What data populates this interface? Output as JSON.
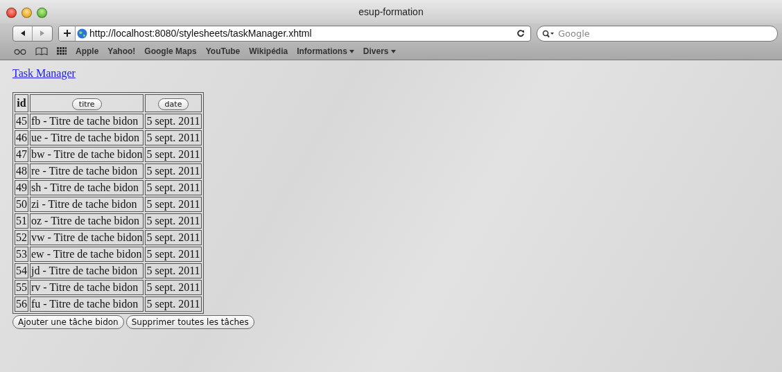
{
  "window": {
    "title": "esup-formation"
  },
  "toolbar": {
    "url": "http://localhost:8080/stylesheets/taskManager.xhtml",
    "search": {
      "placeholder": "Google"
    }
  },
  "bookmarks": [
    {
      "label": "Apple",
      "menu": false
    },
    {
      "label": "Yahoo!",
      "menu": false
    },
    {
      "label": "Google Maps",
      "menu": false
    },
    {
      "label": "YouTube",
      "menu": false
    },
    {
      "label": "Wikipédia",
      "menu": false
    },
    {
      "label": "Informations",
      "menu": true
    },
    {
      "label": "Divers",
      "menu": true
    }
  ],
  "page": {
    "heading_link": "Task Manager",
    "table": {
      "columns": [
        {
          "label": "id",
          "kind": "text"
        },
        {
          "label": "titre",
          "kind": "button"
        },
        {
          "label": "date",
          "kind": "button"
        }
      ],
      "rows": [
        [
          "45",
          "fb - Titre de tache bidon",
          "5 sept. 2011"
        ],
        [
          "46",
          "ue - Titre de tache bidon",
          "5 sept. 2011"
        ],
        [
          "47",
          "bw - Titre de tache bidon",
          "5 sept. 2011"
        ],
        [
          "48",
          "re - Titre de tache bidon",
          "5 sept. 2011"
        ],
        [
          "49",
          "sh - Titre de tache bidon",
          "5 sept. 2011"
        ],
        [
          "50",
          "zi - Titre de tache bidon",
          "5 sept. 2011"
        ],
        [
          "51",
          "oz - Titre de tache bidon",
          "5 sept. 2011"
        ],
        [
          "52",
          "vw - Titre de tache bidon",
          "5 sept. 2011"
        ],
        [
          "53",
          "ew - Titre de tache bidon",
          "5 sept. 2011"
        ],
        [
          "54",
          "jd - Titre de tache bidon",
          "5 sept. 2011"
        ],
        [
          "55",
          "rv - Titre de tache bidon",
          "5 sept. 2011"
        ],
        [
          "56",
          "fu - Titre de tache bidon",
          "5 sept. 2011"
        ]
      ]
    },
    "buttons": [
      "Ajouter une tâche bidon",
      "Supprimer toutes les tâches"
    ]
  }
}
